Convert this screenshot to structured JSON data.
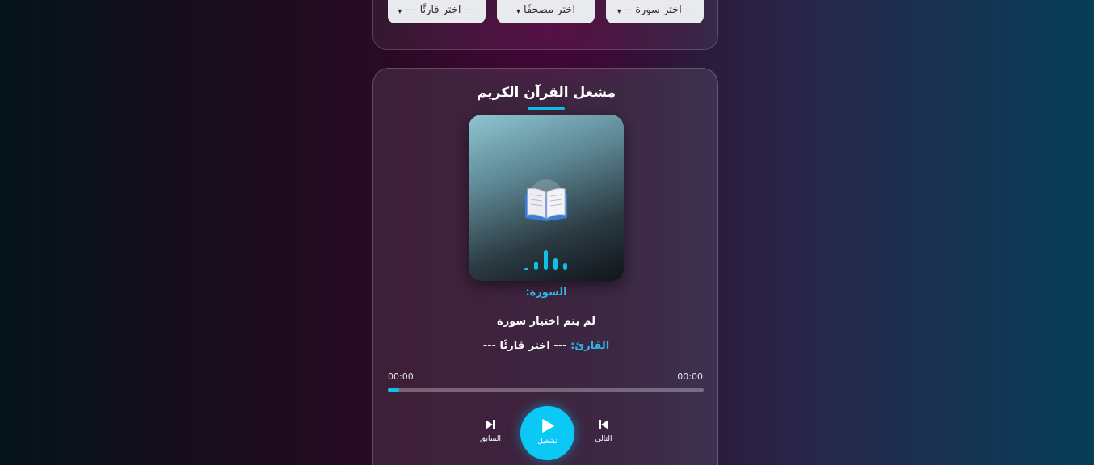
{
  "selectors": {
    "surah": "-- اختر سورة --",
    "mushaf": "اختر مصحفًا",
    "reciter": "--- اختر قارئًا ---"
  },
  "player": {
    "title": "مشغل القرآن الكريم",
    "surah_label": "السورة:",
    "surah_value": "لم يتم اختيار سورة",
    "reciter_label": "القارئ:",
    "reciter_value": "--- اختر قارئًا ---",
    "current_time": "00:00",
    "duration": "00:00",
    "progress": 0.035,
    "next_label": "التالي",
    "play_label": "تشغيل",
    "prev_label": "السابق",
    "accent_color": "#0fc0ea"
  },
  "icons": {
    "cover": "open-book-icon",
    "equalizer": "equalizer-icon",
    "next": "skip-next-icon",
    "play": "play-icon",
    "prev": "skip-prev-icon",
    "dropdown": "chevron-down-icon"
  }
}
